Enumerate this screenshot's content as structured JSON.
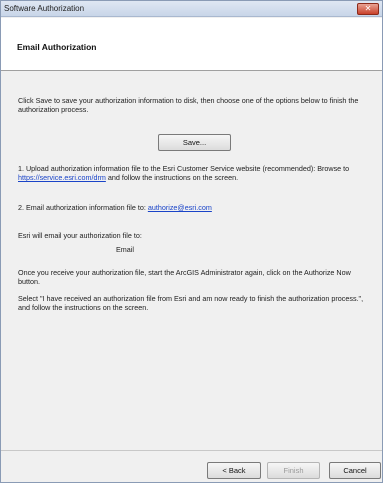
{
  "window": {
    "title": "Software Authorization",
    "close_label": "✕"
  },
  "header": {
    "heading": "Email Authorization"
  },
  "main": {
    "intro": "Click Save to save your authorization information to disk, then choose one of the options below to finish the authorization process.",
    "save_label": "Save...",
    "option1_before": "1.  Upload authorization information file to the Esri Customer Service website (recommended): Browse to ",
    "option1_link": "https://service.esri.com/drm",
    "option1_after": " and follow the instructions on the screen.",
    "option2_before": "2.  Email authorization information file to: ",
    "option2_link": "authorize@esri.com",
    "email_note": "Esri will email your authorization file to:",
    "email_value": "Email",
    "receive_note": "Once you receive your authorization file, start the ArcGIS Administrator again, click on the Authorize Now button.",
    "select_note": "Select \"I have received an authorization file from Esri and am now ready to finish the authorization process.\", and follow the instructions on the screen."
  },
  "footer": {
    "back_label": "< Back",
    "finish_label": "Finish",
    "cancel_label": "Cancel"
  }
}
